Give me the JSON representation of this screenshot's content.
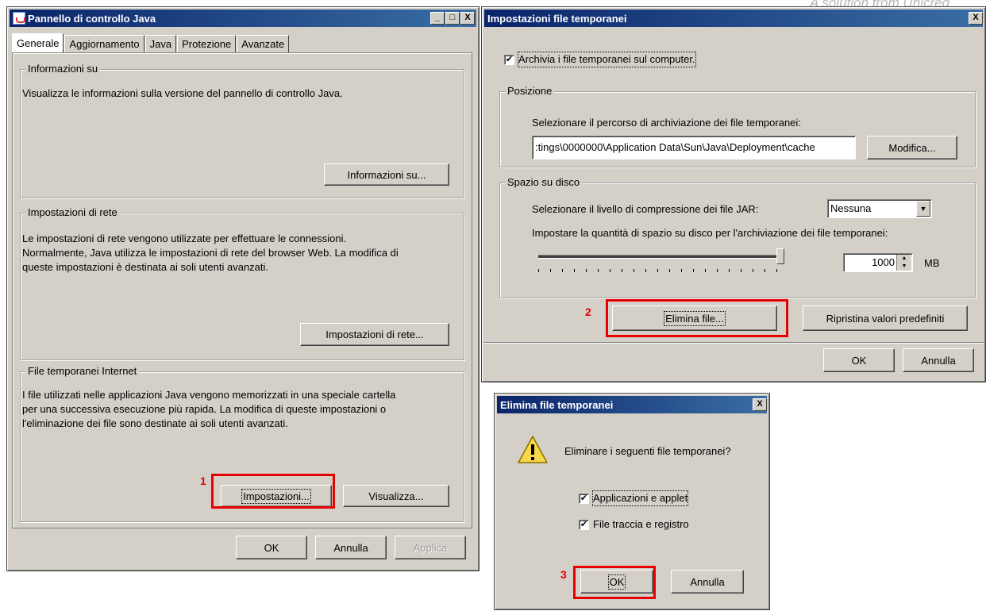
{
  "watermark": "A solution from Unicred",
  "java_panel": {
    "title": "Pannello di controllo Java",
    "title_buttons": [
      "_",
      "□",
      "X"
    ],
    "tabs": [
      "Generale",
      "Aggiornamento",
      "Java",
      "Protezione",
      "Avanzate"
    ],
    "about": {
      "heading": "Informazioni su",
      "text": "Visualizza le informazioni sulla versione del pannello di controllo Java.",
      "button": "Informazioni su..."
    },
    "network": {
      "heading": "Impostazioni di rete",
      "text1": "Le impostazioni di rete vengono utilizzate per effettuare le connessioni.",
      "text2": "Normalmente, Java utilizza le impostazioni di rete del browser Web. La modifica di",
      "text3": "queste impostazioni è destinata ai soli utenti avanzati.",
      "button": "Impostazioni di rete..."
    },
    "temp": {
      "heading": "File temporanei Internet",
      "text1": "I file utilizzati nelle applicazioni Java vengono memorizzati in una speciale cartella",
      "text2": "per una successiva esecuzione più rapida. La modifica di queste impostazioni o",
      "text3": "l'eliminazione dei file sono destinate ai soli utenti avanzati.",
      "settings_button": "Impostazioni...",
      "view_button": "Visualizza..."
    },
    "footer": {
      "ok": "OK",
      "cancel": "Annulla",
      "apply": "Applica"
    }
  },
  "temp_settings": {
    "title": "Impostazioni file temporanei",
    "close": "X",
    "keep_files_label": "Archivia i file temporanei sul computer.",
    "keep_files_checked": true,
    "location": {
      "heading": "Posizione",
      "label": "Selezionare il percorso di archiviazione dei file temporanei:",
      "path": ":tings\\0000000\\Application Data\\Sun\\Java\\Deployment\\cache",
      "change_button": "Modifica..."
    },
    "disk": {
      "heading": "Spazio su disco",
      "compression_label": "Selezionare il livello di compressione dei file JAR:",
      "compression_value": "Nessuna",
      "space_label": "Impostare la quantità di spazio su disco per l'archiviazione dei file temporanei:",
      "space_value": "1000",
      "space_unit": "MB",
      "slider_level": 1.0
    },
    "delete_button": "Elimina file...",
    "restore_button": "Ripristina valori predefiniti",
    "footer": {
      "ok": "OK",
      "cancel": "Annulla"
    }
  },
  "delete_dialog": {
    "title": "Elimina file temporanei",
    "close": "X",
    "question": "Eliminare i seguenti file temporanei?",
    "option1": "Applicazioni e applet",
    "option1_checked": true,
    "option2": "File traccia e registro",
    "option2_checked": true,
    "ok": "OK",
    "cancel": "Annulla"
  },
  "steps": [
    "1",
    "2",
    "3"
  ],
  "colors": {
    "highlight": "#e60000",
    "titlebar": "#0a246a",
    "face": "#d4d0c8"
  }
}
